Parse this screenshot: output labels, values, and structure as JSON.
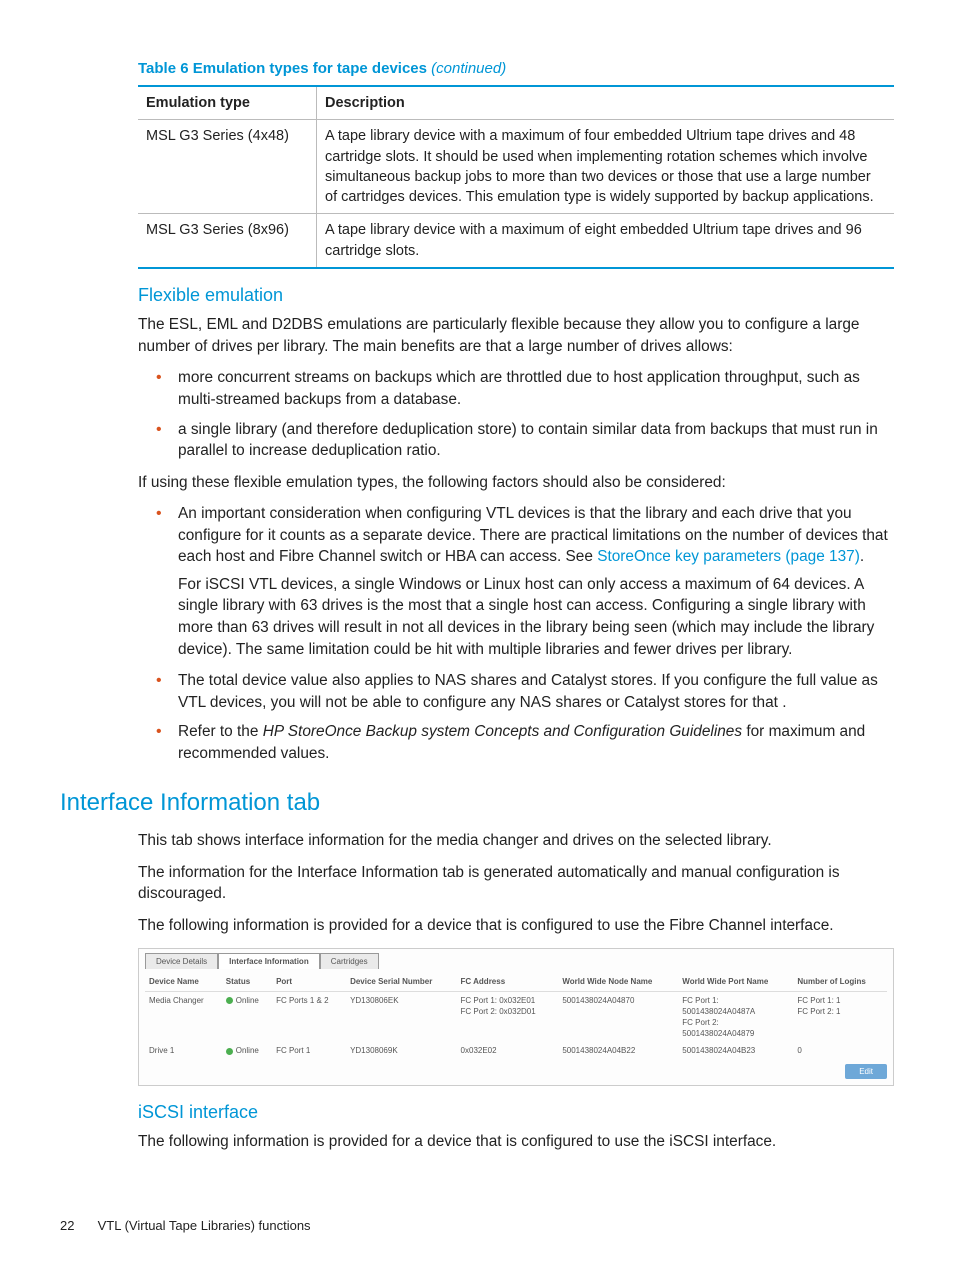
{
  "table": {
    "caption_prefix": "Table 6 Emulation types for tape devices ",
    "caption_suffix": "(continued)",
    "headers": [
      "Emulation type",
      "Description"
    ],
    "rows": [
      {
        "type": "MSL G3 Series (4x48)",
        "desc": "A tape library device with a maximum of four embedded Ultrium tape drives and 48 cartridge slots. It should be used when implementing rotation schemes which involve simultaneous backup jobs to more than two devices or those that use a large number of cartridges devices. This emulation type is widely supported by backup applications."
      },
      {
        "type": "MSL G3 Series (8x96)",
        "desc": "A tape library device with a maximum of eight embedded Ultrium tape drives and 96 cartridge slots."
      }
    ]
  },
  "flex_heading": "Flexible emulation",
  "flex_intro": "The ESL, EML and D2DBS emulations are particularly flexible because they allow you to configure a large number of drives per library. The main benefits are that a large number of drives allows:",
  "flex_bullets": [
    "more concurrent streams on backups which are throttled due to host application throughput, such as multi-streamed backups from a database.",
    "a single library (and therefore deduplication store) to contain similar data from backups that must run in parallel to increase deduplication ratio."
  ],
  "flex_mid": "If using these flexible emulation types, the following factors should also be considered:",
  "flex_bullets2_0a": "An important consideration when configuring VTL devices is that the library and each drive that you configure for it counts as a separate device. There are practical limitations on the number of devices that each host and Fibre Channel switch or HBA can access. See ",
  "flex_bullets2_0_link": "StoreOnce key parameters (page 137)",
  "flex_bullets2_0b": ".",
  "flex_bullets2_0_nested": "For iSCSI VTL devices, a single Windows or Linux host can only access a maximum of 64 devices. A single library with 63 drives is the most that a single host can access. Configuring a single library with more than 63 drives will result in not all devices in the library being seen (which may include the library device). The same limitation could be hit with multiple libraries and fewer drives per library.",
  "flex_bullets2_1": "The total device value also applies to NAS shares and Catalyst stores. If you configure the full value as VTL devices, you will not be able to configure any NAS shares or Catalyst stores for that .",
  "flex_bullets2_2a": "Refer to the ",
  "flex_bullets2_2_ref": "HP StoreOnce Backup system Concepts and Configuration Guidelines",
  "flex_bullets2_2b": " for maximum and recommended values.",
  "iit_heading": "Interface Information tab",
  "iit_p1": "This tab shows interface information for the media changer and drives on the selected library.",
  "iit_p2": "The information for the Interface Information tab is generated automatically and manual configuration is discouraged.",
  "iit_p3": "The following information is provided for a device that is configured to use the Fibre Channel interface.",
  "screenshot": {
    "tabs": [
      "Device Details",
      "Interface Information",
      "Cartridges"
    ],
    "headers": [
      "Device Name",
      "Status",
      "Port",
      "Device Serial Number",
      "FC Address",
      "World Wide Node Name",
      "World Wide Port Name",
      "Number of Logins"
    ],
    "rows": [
      {
        "name": "Media Changer",
        "status": "Online",
        "port": "FC Ports 1 & 2",
        "serial": "YD130806EK",
        "fcaddr": "FC Port 1: 0x032E01\nFC Port 2: 0x032D01",
        "wwnn": "5001438024A04870",
        "wwpn": "FC Port 1:\n5001438024A0487A\nFC Port 2:\n5001438024A04879",
        "logins": "FC Port 1: 1\nFC Port 2: 1"
      },
      {
        "name": "Drive 1",
        "status": "Online",
        "port": "FC Port 1",
        "serial": "YD1308069K",
        "fcaddr": "0x032E02",
        "wwnn": "5001438024A04B22",
        "wwpn": "5001438024A04B23",
        "logins": "0"
      }
    ],
    "edit": "Edit"
  },
  "iscsi_heading": "iSCSI interface",
  "iscsi_p": "The following information is provided for a device that is configured to use the iSCSI interface.",
  "footer_page": "22",
  "footer_title": "VTL (Virtual Tape Libraries) functions"
}
